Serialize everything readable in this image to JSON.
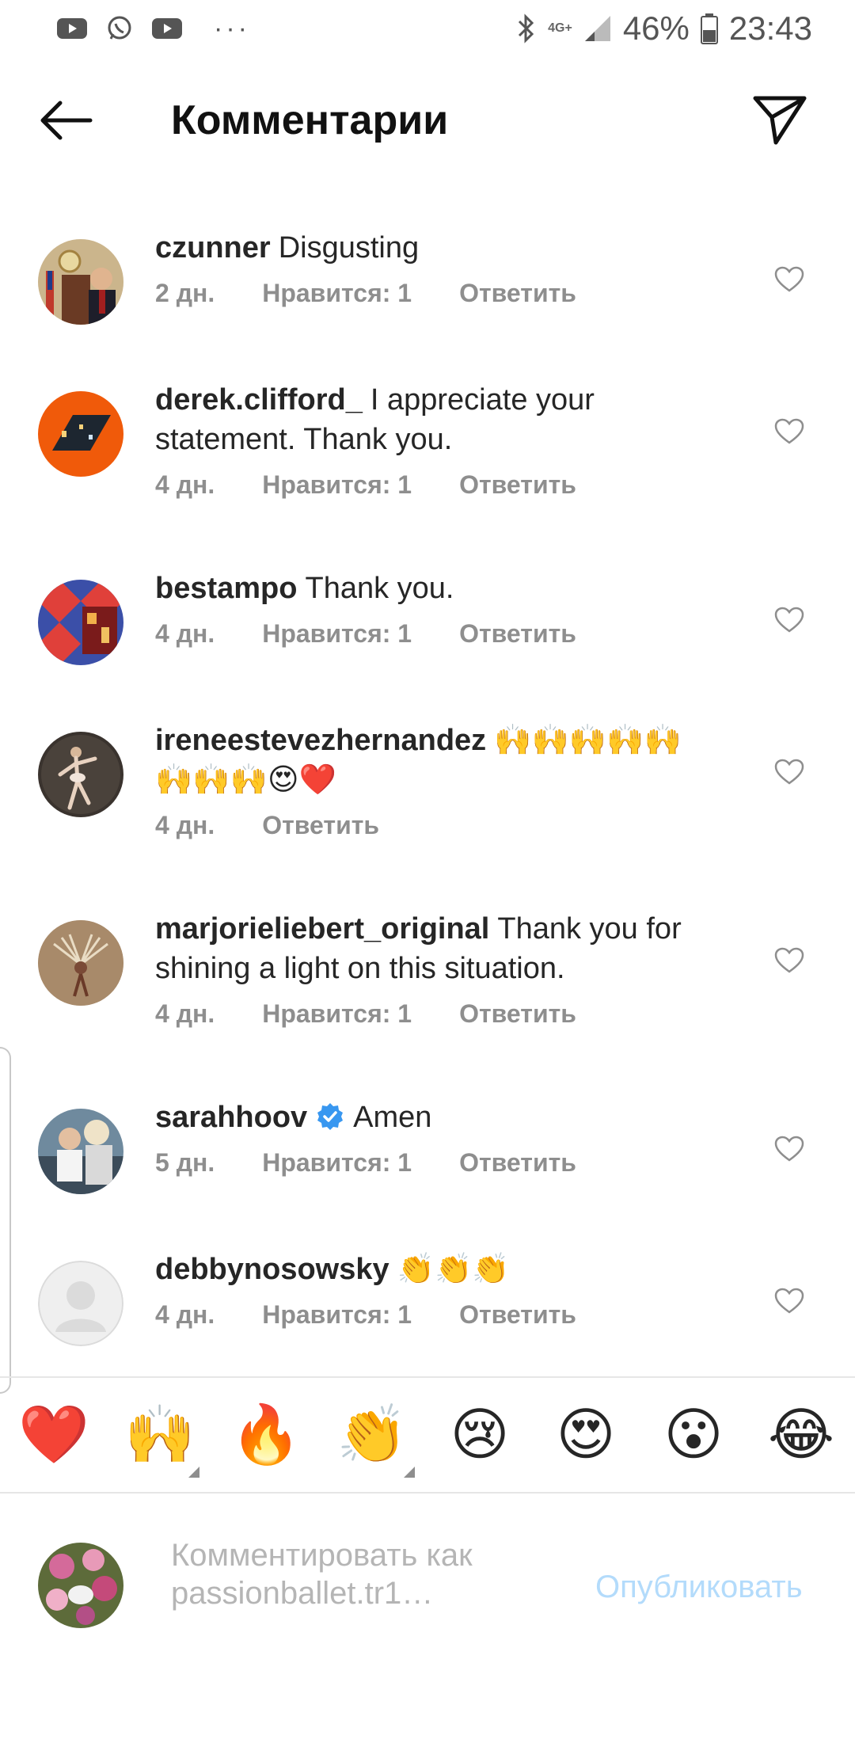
{
  "status_bar": {
    "battery": "46%",
    "time": "23:43",
    "network": "4G+",
    "icons": [
      "youtube-icon",
      "whatsapp-icon",
      "youtube-icon",
      "more-dots-icon",
      "bluetooth-icon",
      "signal-icon",
      "battery-icon"
    ]
  },
  "header": {
    "title": "Комментарии"
  },
  "comments": [
    {
      "user": "czunner",
      "text": "Disgusting",
      "time": "2 дн.",
      "likes": "Нравится: 1",
      "reply": "Ответить"
    },
    {
      "user": "derek.clifford_",
      "text": "I appreciate your statement. Thank you.",
      "time": "4 дн.",
      "likes": "Нравится: 1",
      "reply": "Ответить"
    },
    {
      "user": "bestampo",
      "text": "Thank you.",
      "time": "4 дн.",
      "likes": "Нравится: 1",
      "reply": "Ответить"
    },
    {
      "user": "ireneestevezhernandez",
      "text": "🙌🙌🙌🙌🙌🙌🙌🙌😍❤️",
      "time": "4 дн.",
      "likes": "",
      "reply": "Ответить"
    },
    {
      "user": "marjorieliebert_original",
      "text": "Thank you for shining a light on this situation.",
      "time": "4 дн.",
      "likes": "Нравится: 1",
      "reply": "Ответить"
    },
    {
      "user": "sarahhoov",
      "text": "Amen",
      "time": "5 дн.",
      "likes": "Нравится: 1",
      "reply": "Ответить"
    },
    {
      "user": "debbynosowsky",
      "text": "👏👏👏",
      "time": "4 дн.",
      "likes": "Нравится: 1",
      "reply": "Ответить"
    }
  ],
  "emoji_bar": [
    "❤️",
    "🙌",
    "🔥",
    "👏",
    "😢",
    "😍",
    "😮",
    "😂"
  ],
  "composer": {
    "placeholder": "Комментировать как passionballet.tr1…",
    "placeholder_line1": "Комментировать как",
    "placeholder_line2": "passionballet.tr1…",
    "publish": "Опубликовать"
  },
  "colors": {
    "text": "#262626",
    "meta": "#8e8e8e",
    "publish_disabled": "#b3dbfb",
    "verified": "#3897f0"
  }
}
